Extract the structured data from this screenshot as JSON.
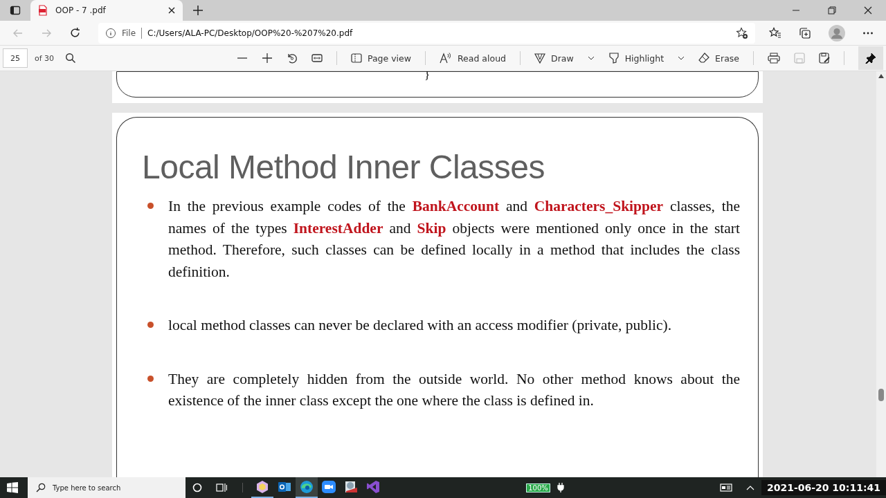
{
  "tab": {
    "title": "OOP - 7 .pdf"
  },
  "address_bar": {
    "prefix": "File",
    "url": "C:/Users/ALA-PC/Desktop/OOP%20-%207%20.pdf"
  },
  "pdf_toolbar": {
    "page": "25",
    "total": "of 30",
    "page_view": "Page view",
    "read_aloud": "Read aloud",
    "draw": "Draw",
    "highlight": "Highlight",
    "erase": "Erase",
    "pinned": true
  },
  "previous_page": {
    "fragment": "}"
  },
  "slide": {
    "title": "Local Method Inner Classes",
    "bullets": [
      "In the previous example codes of the **BankAccount** and **Characters_Skipper** classes, the names of the types **InterestAdder** and **Skip** objects were mentioned only once in the start method. Therefore, such classes can be defined locally in a method that includes the class definition.",
      "local method classes can never be declared with an access modifier (private, public).",
      "They are completely hidden from the outside world. No other method knows about the existence of the inner class except the one where the class is defined in."
    ]
  },
  "taskbar": {
    "search_placeholder": "Type here to search",
    "apps": [
      {
        "kind": "cube",
        "selected": false,
        "running": true
      },
      {
        "kind": "mail",
        "selected": false,
        "running": false
      },
      {
        "kind": "browser",
        "selected": true,
        "running": true
      },
      {
        "kind": "video",
        "selected": false,
        "running": false
      },
      {
        "kind": "scanner",
        "selected": false,
        "running": false
      },
      {
        "kind": "ide",
        "selected": false,
        "running": false
      }
    ],
    "battery": "100%",
    "clock": "2021-06-20 10:11:41"
  }
}
